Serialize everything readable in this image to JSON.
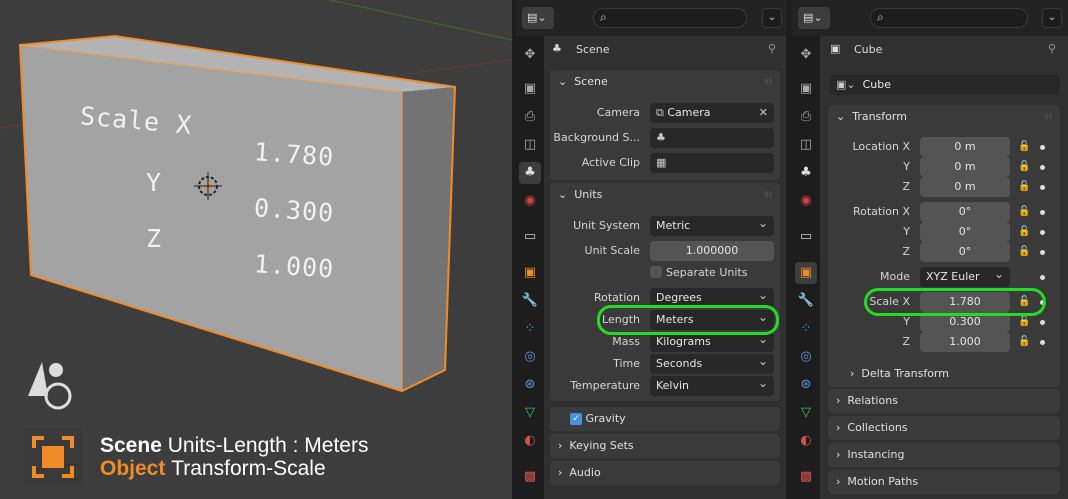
{
  "viewport": {
    "cube_labels": {
      "scale_x": "Scale X",
      "y": "Y",
      "z": "Z"
    },
    "cube_values": {
      "x": "1.780",
      "y": "0.300",
      "z": "1.000"
    },
    "caption": {
      "line1_bold": "Scene",
      "line1_rest": "Units-Length : Meters",
      "line2_bold": "Object",
      "line2_rest": "Transform-Scale"
    }
  },
  "scene_panel": {
    "context": "Scene",
    "scene_section": {
      "title": "Scene",
      "camera_label": "Camera",
      "camera_value": "Camera",
      "background_label": "Background S...",
      "active_clip_label": "Active Clip"
    },
    "units_section": {
      "title": "Units",
      "unit_system_label": "Unit System",
      "unit_system_value": "Metric",
      "unit_scale_label": "Unit Scale",
      "unit_scale_value": "1.000000",
      "separate_units_label": "Separate Units",
      "rotation_label": "Rotation",
      "rotation_value": "Degrees",
      "length_label": "Length",
      "length_value": "Meters",
      "mass_label": "Mass",
      "mass_value": "Kilograms",
      "time_label": "Time",
      "time_value": "Seconds",
      "temperature_label": "Temperature",
      "temperature_value": "Kelvin"
    },
    "collapsed": [
      "Gravity",
      "Keying Sets",
      "Audio"
    ]
  },
  "object_panel": {
    "context": "Cube",
    "name_value": "Cube",
    "transform": {
      "title": "Transform",
      "location_label": "Location X",
      "location": [
        "0 m",
        "0 m",
        "0 m"
      ],
      "rotation_label": "Rotation X",
      "rotation": [
        "0°",
        "0°",
        "0°"
      ],
      "mode_label": "Mode",
      "mode_value": "XYZ Euler",
      "scale_label": "Scale X",
      "scale": [
        "1.780",
        "0.300",
        "1.000"
      ],
      "y": "Y",
      "z": "Z",
      "delta": "Delta Transform"
    },
    "collapsed": [
      "Relations",
      "Collections",
      "Instancing",
      "Motion Paths"
    ]
  },
  "colors": {
    "accent_orange": "#f08c28",
    "highlight_green": "#22dd22"
  }
}
